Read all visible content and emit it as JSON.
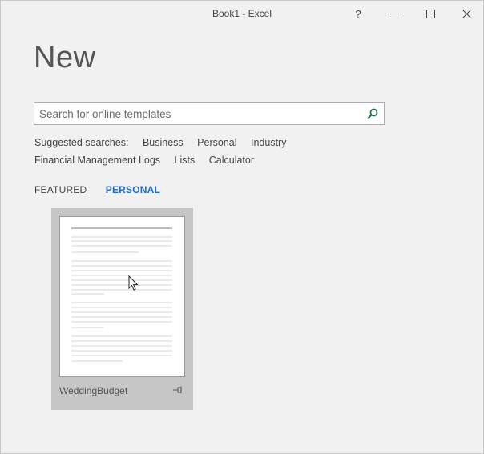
{
  "window": {
    "title": "Book1 - Excel",
    "help_label": "?"
  },
  "page": {
    "heading": "New"
  },
  "search": {
    "placeholder": "Search for online templates"
  },
  "suggested": {
    "label": "Suggested searches:",
    "items": [
      "Business",
      "Personal",
      "Industry",
      "Financial Management",
      "Logs",
      "Lists",
      "Calculator"
    ]
  },
  "tabs": {
    "featured": "FEATURED",
    "personal": "PERSONAL",
    "active": "personal"
  },
  "templates": [
    {
      "name": "WeddingBudget"
    }
  ],
  "colors": {
    "accent": "#1e6ec8",
    "search_icon": "#217346",
    "tile_selected": "#c6c6c6"
  }
}
